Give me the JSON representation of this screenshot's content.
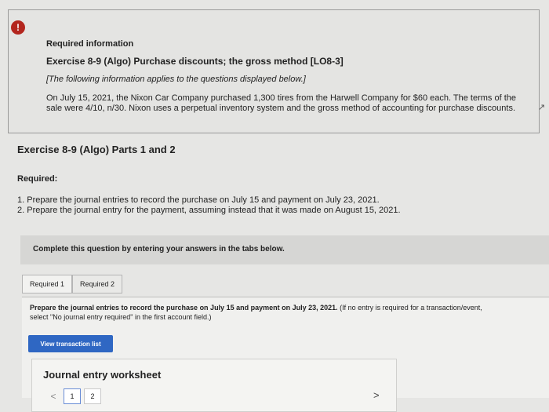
{
  "info": {
    "alert_glyph": "!",
    "heading": "Required information",
    "exercise_title": "Exercise 8-9 (Algo) Purchase discounts; the gross method [LO8-3]",
    "note": "[The following information applies to the questions displayed below.]",
    "description": "On July 15, 2021, the Nixon Car Company purchased 1,300 tires from the Harwell Company for $60 each. The terms of the sale were 4/10, n/30. Nixon uses a perpetual inventory system and the gross method of accounting for purchase discounts."
  },
  "parts_title": "Exercise 8-9 (Algo) Parts 1 and 2",
  "required_label": "Required:",
  "requirements": [
    "1. Prepare the journal entries to record the purchase on July 15 and payment on July 23, 2021.",
    "2. Prepare the journal entry for the payment, assuming instead that it was made on August 15, 2021."
  ],
  "instruction": "Complete this question by entering your answers in the tabs below.",
  "tabs": [
    {
      "label": "Required 1"
    },
    {
      "label": "Required 2"
    }
  ],
  "question": {
    "text": "Prepare the journal entries to record the purchase on July 15 and payment on July 23, 2021.",
    "hint": "(If no entry is required for a transaction/event, select \"No journal entry required\" in the first account field.)"
  },
  "view_button_label": "View transaction list",
  "worksheet": {
    "title": "Journal entry worksheet",
    "prev_glyph": "<",
    "pages": [
      "1",
      "2"
    ],
    "next_glyph": ">"
  }
}
